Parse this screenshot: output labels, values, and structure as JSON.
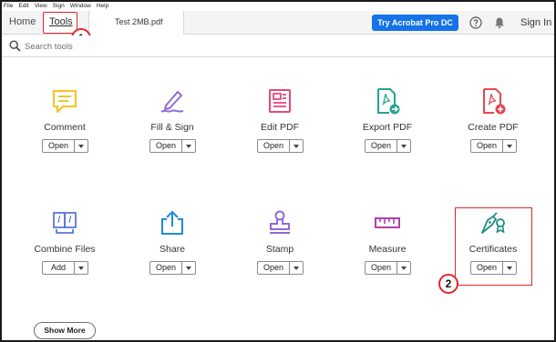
{
  "menu": [
    "File",
    "Edit",
    "View",
    "Sign",
    "Window",
    "Help"
  ],
  "tabs": {
    "home": "Home",
    "tools": "Tools",
    "document": "Test 2MB.pdf"
  },
  "header": {
    "try_button": "Try Acrobat Pro DC",
    "sign_in": "Sign In"
  },
  "search": {
    "placeholder": "Search tools"
  },
  "callouts": {
    "first": "1",
    "second": "2"
  },
  "tools_row1": [
    {
      "label": "Comment",
      "button": "Open",
      "icon": "comment-icon",
      "color": "#f5c42d"
    },
    {
      "label": "Fill & Sign",
      "button": "Open",
      "icon": "fill-sign-icon",
      "color": "#8f6bd6"
    },
    {
      "label": "Edit PDF",
      "button": "Open",
      "icon": "edit-pdf-icon",
      "color": "#e5487d"
    },
    {
      "label": "Export PDF",
      "button": "Open",
      "icon": "export-pdf-icon",
      "color": "#27a28f"
    },
    {
      "label": "Create PDF",
      "button": "Open",
      "icon": "create-pdf-icon",
      "color": "#e34850"
    }
  ],
  "tools_row2": [
    {
      "label": "Combine Files",
      "button": "Add",
      "icon": "combine-files-icon",
      "color": "#5a78d6"
    },
    {
      "label": "Share",
      "button": "Open",
      "icon": "share-icon",
      "color": "#1d8cd8"
    },
    {
      "label": "Stamp",
      "button": "Open",
      "icon": "stamp-icon",
      "color": "#8f6bd6"
    },
    {
      "label": "Measure",
      "button": "Open",
      "icon": "measure-icon",
      "color": "#b03fae"
    },
    {
      "label": "Certificates",
      "button": "Open",
      "icon": "certificates-icon",
      "color": "#1d8c84"
    }
  ],
  "show_more": "Show More",
  "colors": {
    "accent_red": "#e3262b",
    "brand_blue": "#1473e6"
  }
}
